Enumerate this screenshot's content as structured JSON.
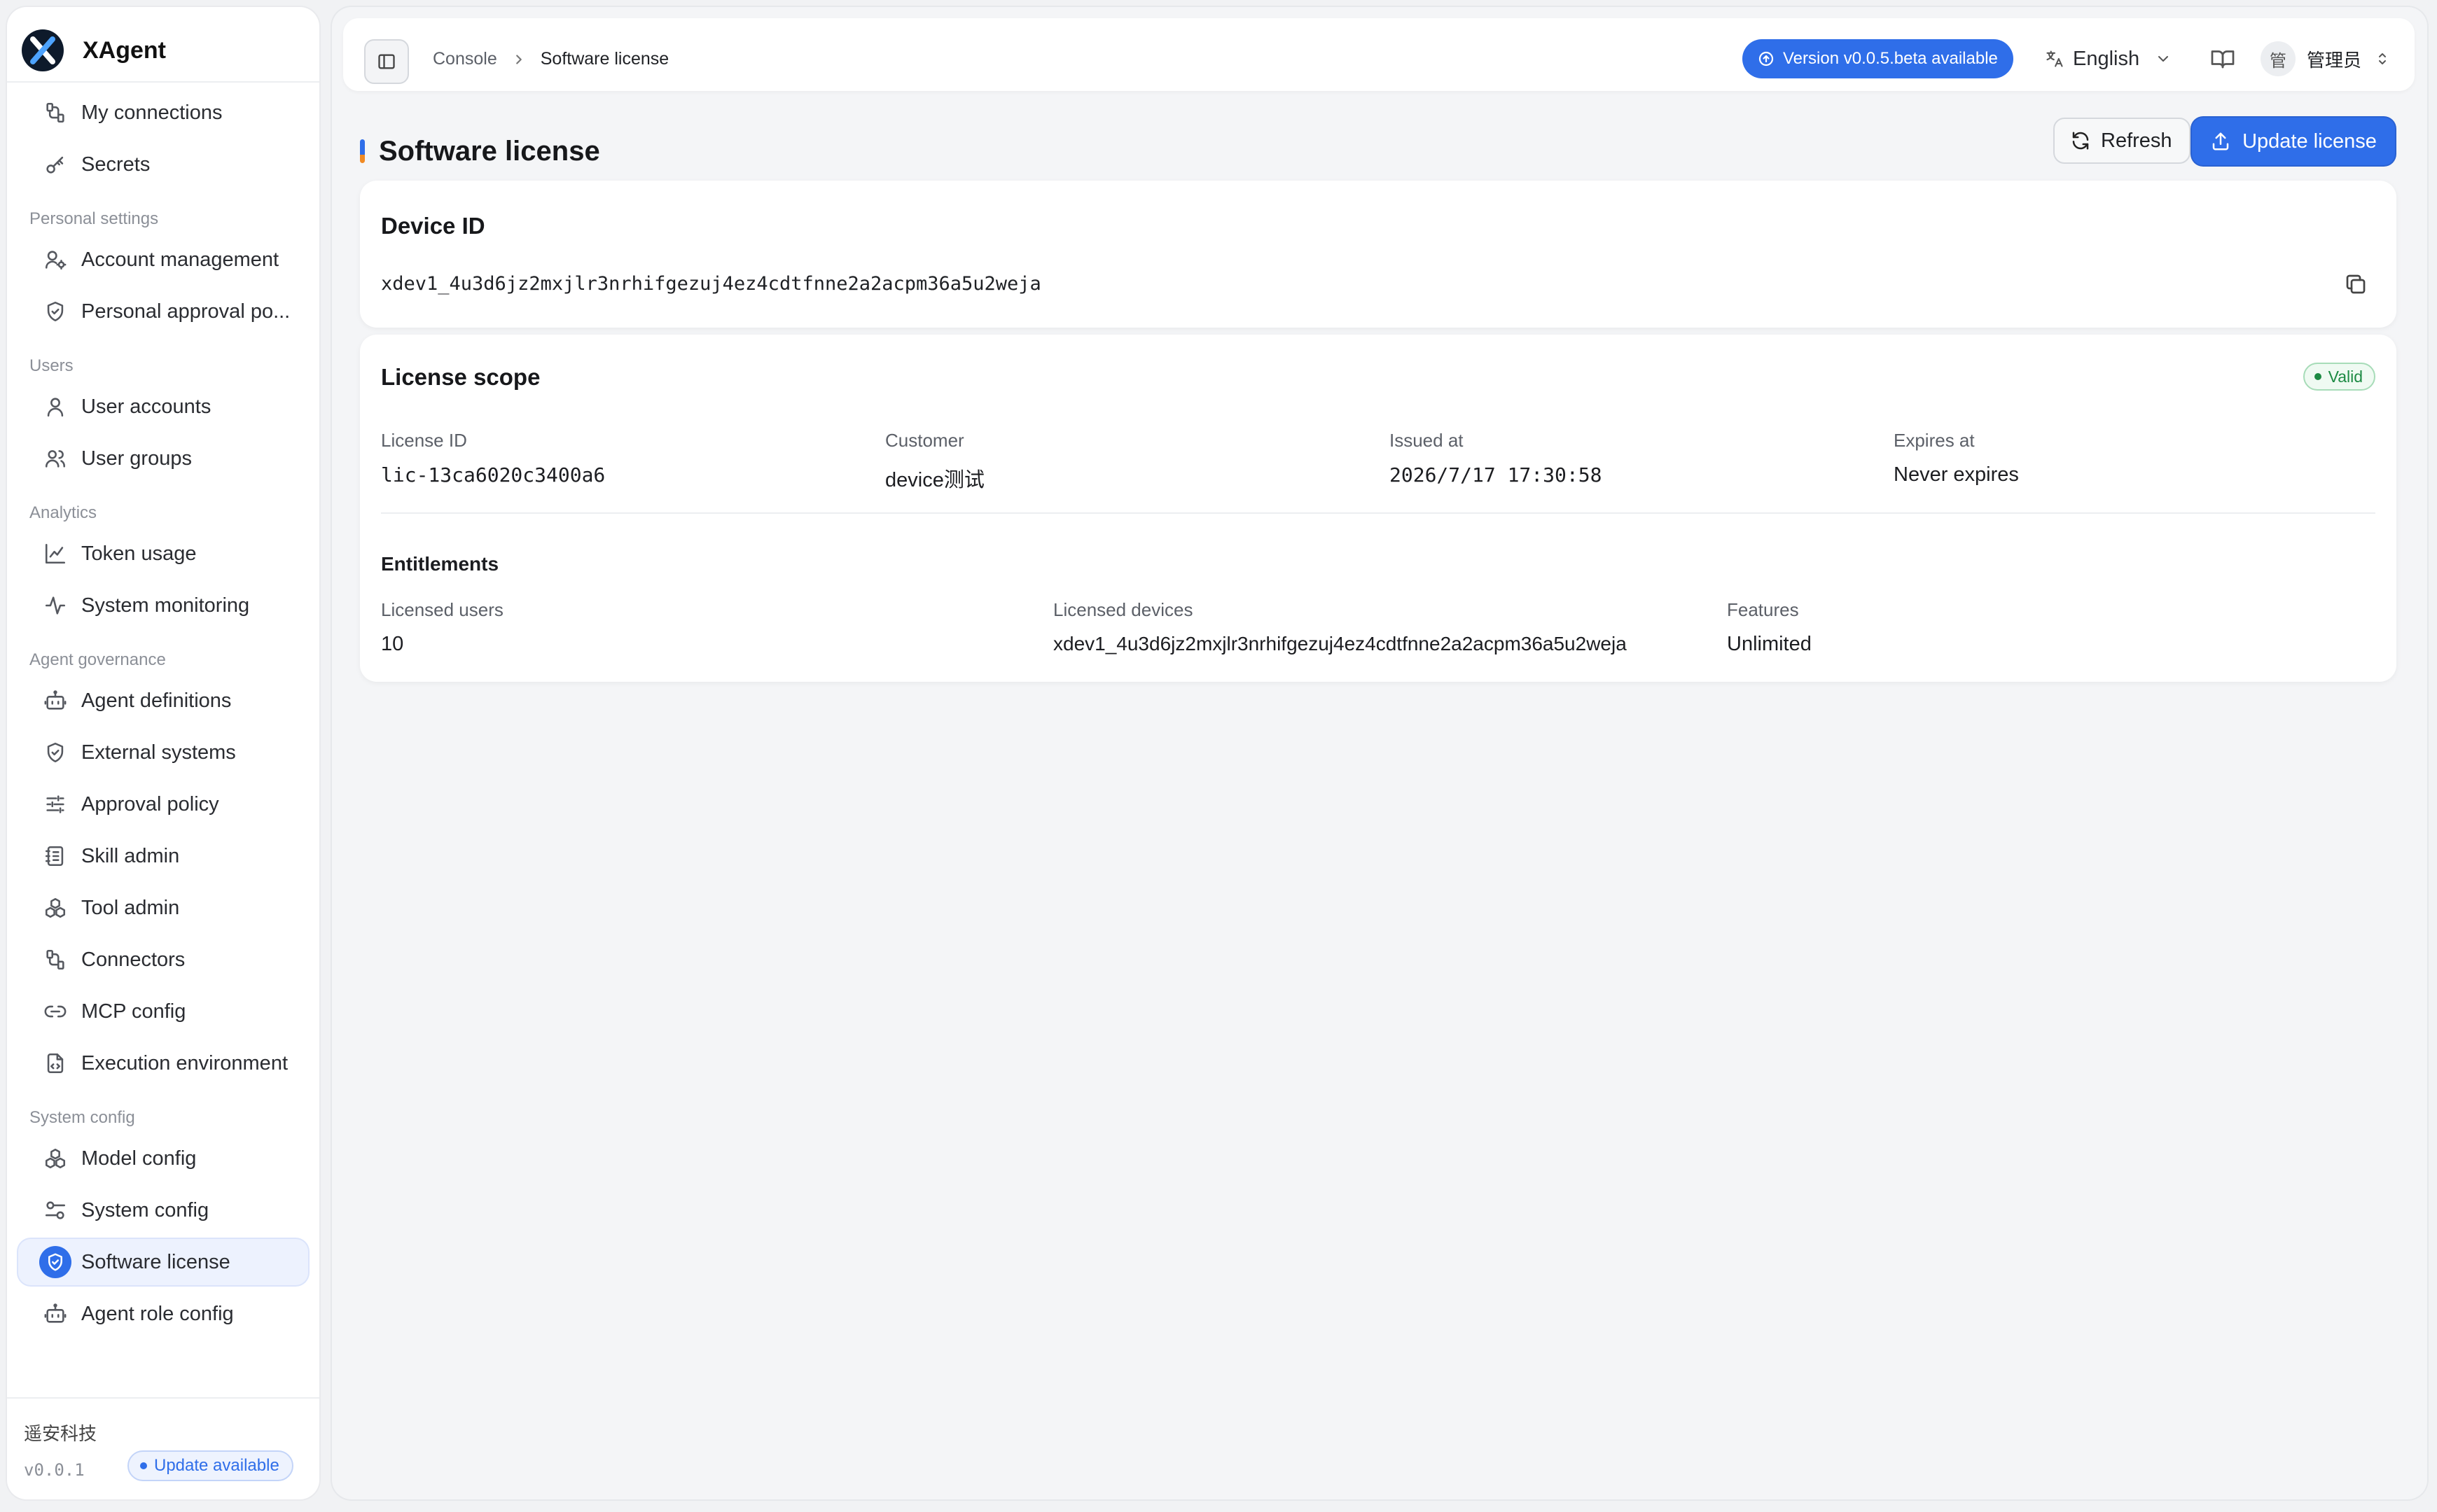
{
  "app": {
    "name": "XAgent"
  },
  "sidebar": {
    "top_items": [
      {
        "label": "My connections",
        "icon": "connections-icon"
      },
      {
        "label": "Secrets",
        "icon": "key-icon"
      }
    ],
    "groups": [
      {
        "title": "Personal settings",
        "items": [
          {
            "label": "Account management",
            "icon": "user-cog-icon"
          },
          {
            "label": "Personal approval po...",
            "icon": "shield-check-icon"
          }
        ]
      },
      {
        "title": "Users",
        "items": [
          {
            "label": "User accounts",
            "icon": "user-icon"
          },
          {
            "label": "User groups",
            "icon": "users-icon"
          }
        ]
      },
      {
        "title": "Analytics",
        "items": [
          {
            "label": "Token usage",
            "icon": "line-chart-icon"
          },
          {
            "label": "System monitoring",
            "icon": "activity-icon"
          }
        ]
      },
      {
        "title": "Agent governance",
        "items": [
          {
            "label": "Agent definitions",
            "icon": "bot-icon"
          },
          {
            "label": "External systems",
            "icon": "shield-icon"
          },
          {
            "label": "Approval policy",
            "icon": "sliders-icon"
          },
          {
            "label": "Skill admin",
            "icon": "notebook-icon"
          },
          {
            "label": "Tool admin",
            "icon": "boxes-icon"
          },
          {
            "label": "Connectors",
            "icon": "connections-icon"
          },
          {
            "label": "MCP config",
            "icon": "link-icon"
          },
          {
            "label": "Execution environment",
            "icon": "file-code-icon"
          }
        ]
      },
      {
        "title": "System config",
        "items": [
          {
            "label": "Model config",
            "icon": "boxes-icon"
          },
          {
            "label": "System config",
            "icon": "toggles-icon"
          },
          {
            "label": "Software license",
            "icon": "shield-check-icon",
            "active": true
          },
          {
            "label": "Agent role config",
            "icon": "bot-icon"
          }
        ]
      }
    ],
    "footer": {
      "company": "遥安科技",
      "version": "v0.0.1",
      "update_badge": "Update available"
    }
  },
  "topbar": {
    "breadcrumb": {
      "home": "Console",
      "current": "Software license"
    },
    "version_pill": "Version v0.0.5.beta available",
    "language": "English",
    "user": {
      "avatar": "管",
      "name": "管理员"
    }
  },
  "page": {
    "title": "Software license",
    "refresh_label": "Refresh",
    "update_label": "Update license"
  },
  "device_card": {
    "title": "Device ID",
    "device_id": "xdev1_4u3d6jz2mxjlr3nrhifgezuj4ez4cdtfnne2a2acpm36a5u2weja"
  },
  "license_card": {
    "title": "License scope",
    "status": "Valid",
    "fields": [
      {
        "label": "License ID",
        "value": "lic-13ca6020c3400a6"
      },
      {
        "label": "Customer",
        "value": "device测试"
      },
      {
        "label": "Issued at",
        "value": "2026/7/17 17:30:58"
      },
      {
        "label": "Expires at",
        "value": "Never expires"
      }
    ],
    "entitlements_title": "Entitlements",
    "entitlements": [
      {
        "label": "Licensed users",
        "value": "10"
      },
      {
        "label": "Licensed devices",
        "value": "xdev1_4u3d6jz2mxjlr3nrhifgezuj4ez4cdtfnne2a2acpm36a5u2weja"
      },
      {
        "label": "Features",
        "value": "Unlimited"
      }
    ]
  },
  "colors": {
    "accent": "#2f6ee9",
    "valid": "#1c8a43",
    "background": "#f4f5f7"
  }
}
